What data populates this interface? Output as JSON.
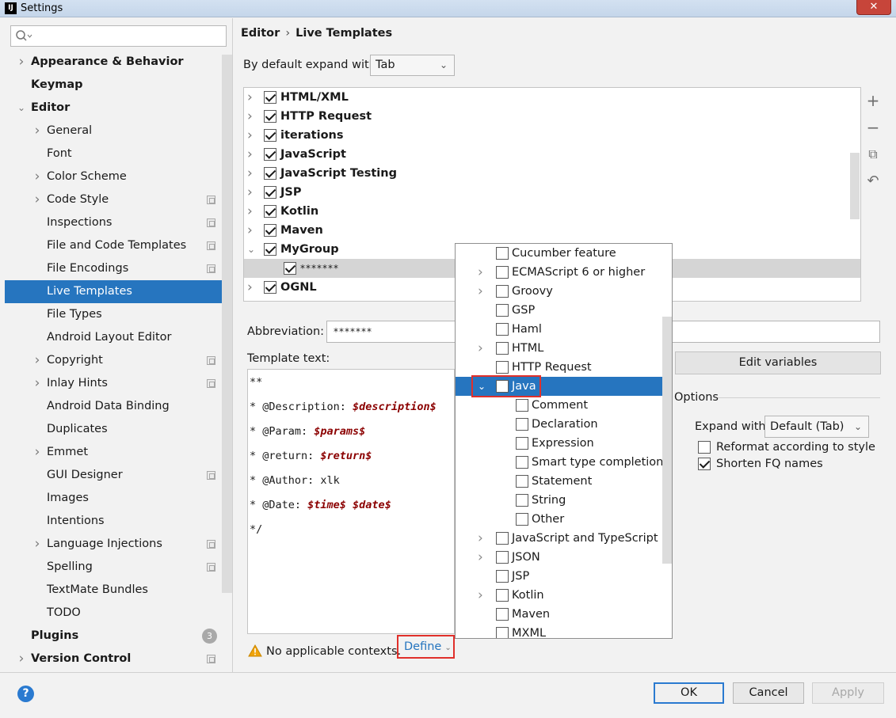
{
  "window": {
    "title": "Settings",
    "app_icon": "IJ",
    "close": "✕"
  },
  "search": {
    "placeholder": ""
  },
  "sidebar": {
    "items": [
      {
        "label": "Appearance & Behavior",
        "bold": true,
        "arrow": "right"
      },
      {
        "label": "Keymap",
        "bold": true
      },
      {
        "label": "Editor",
        "bold": true,
        "arrow": "down"
      },
      {
        "label": "General",
        "arrow": "right",
        "indent": 1
      },
      {
        "label": "Font",
        "indent": 1
      },
      {
        "label": "Color Scheme",
        "arrow": "right",
        "indent": 1
      },
      {
        "label": "Code Style",
        "arrow": "right",
        "indent": 1,
        "project": true
      },
      {
        "label": "Inspections",
        "indent": 1,
        "project": true
      },
      {
        "label": "File and Code Templates",
        "indent": 1,
        "project": true
      },
      {
        "label": "File Encodings",
        "indent": 1,
        "project": true
      },
      {
        "label": "Live Templates",
        "indent": 1,
        "selected": true
      },
      {
        "label": "File Types",
        "indent": 1
      },
      {
        "label": "Android Layout Editor",
        "indent": 1
      },
      {
        "label": "Copyright",
        "arrow": "right",
        "indent": 1,
        "project": true
      },
      {
        "label": "Inlay Hints",
        "arrow": "right",
        "indent": 1,
        "project": true
      },
      {
        "label": "Android Data Binding",
        "indent": 1
      },
      {
        "label": "Duplicates",
        "indent": 1
      },
      {
        "label": "Emmet",
        "arrow": "right",
        "indent": 1
      },
      {
        "label": "GUI Designer",
        "indent": 1,
        "project": true
      },
      {
        "label": "Images",
        "indent": 1
      },
      {
        "label": "Intentions",
        "indent": 1
      },
      {
        "label": "Language Injections",
        "arrow": "right",
        "indent": 1,
        "project": true
      },
      {
        "label": "Spelling",
        "indent": 1,
        "project": true
      },
      {
        "label": "TextMate Bundles",
        "indent": 1
      },
      {
        "label": "TODO",
        "indent": 1
      },
      {
        "label": "Plugins",
        "bold": true,
        "badge": "3"
      },
      {
        "label": "Version Control",
        "bold": true,
        "arrow": "right",
        "project": true
      }
    ]
  },
  "breadcrumb": {
    "parent": "Editor",
    "separator": "›",
    "current": "Live Templates"
  },
  "expand": {
    "label": "By default expand with",
    "value": "Tab"
  },
  "template_groups": [
    {
      "label": "HTML/XML",
      "checked": true,
      "expanded": false
    },
    {
      "label": "HTTP Request",
      "checked": true,
      "expanded": false
    },
    {
      "label": "iterations",
      "checked": true,
      "expanded": false
    },
    {
      "label": "JavaScript",
      "checked": true,
      "expanded": false
    },
    {
      "label": "JavaScript Testing",
      "checked": true,
      "expanded": false
    },
    {
      "label": "JSP",
      "checked": true,
      "expanded": false
    },
    {
      "label": "Kotlin",
      "checked": true,
      "expanded": false
    },
    {
      "label": "Maven",
      "checked": true,
      "expanded": false
    },
    {
      "label": "MyGroup",
      "checked": true,
      "expanded": true
    },
    {
      "label": "*******",
      "checked": true,
      "child": true,
      "selected": true
    },
    {
      "label": "OGNL",
      "checked": true,
      "expanded": false
    }
  ],
  "toolbar": {
    "add": "+",
    "remove": "−",
    "copy": "⧉",
    "undo": "↶"
  },
  "abbreviation": {
    "label": "Abbreviation:",
    "value": "*******"
  },
  "template_text": {
    "label": "Template text:",
    "lines": [
      {
        "text": "**"
      },
      {
        "text": "* @Description: ",
        "var": "$description$"
      },
      {
        "text": "* @Param: ",
        "var": "$params$"
      },
      {
        "text": "* @return: ",
        "var": "$return$"
      },
      {
        "text": "* @Author: xlk"
      },
      {
        "text": "* @Date: ",
        "var": "$time$ $date$"
      },
      {
        "text": "*/"
      }
    ]
  },
  "edit_variables": "Edit variables",
  "options": {
    "label": "Options",
    "expand_with_label": "Expand with",
    "expand_with_value": "Default (Tab)",
    "reformat": {
      "label": "Reformat according to style",
      "checked": false
    },
    "shorten": {
      "label": "Shorten FQ names",
      "checked": true
    }
  },
  "contexts": {
    "warning": "No applicable contexts.",
    "define": "Define"
  },
  "context_popup": [
    {
      "label": "Cucumber feature",
      "checked": false
    },
    {
      "label": "ECMAScript 6 or higher",
      "checked": false,
      "arrow": "right"
    },
    {
      "label": "Groovy",
      "checked": false,
      "arrow": "right"
    },
    {
      "label": "GSP",
      "checked": false
    },
    {
      "label": "Haml",
      "checked": false
    },
    {
      "label": "HTML",
      "checked": false,
      "arrow": "right"
    },
    {
      "label": "HTTP Request",
      "checked": false
    },
    {
      "label": "Java",
      "checked": false,
      "arrow": "down",
      "selected": true
    },
    {
      "label": "Comment",
      "checked": false,
      "child": true
    },
    {
      "label": "Declaration",
      "checked": false,
      "child": true
    },
    {
      "label": "Expression",
      "checked": false,
      "child": true
    },
    {
      "label": "Smart type completion",
      "checked": false,
      "child": true
    },
    {
      "label": "Statement",
      "checked": false,
      "child": true
    },
    {
      "label": "String",
      "checked": false,
      "child": true
    },
    {
      "label": "Other",
      "checked": false,
      "child": true
    },
    {
      "label": "JavaScript and TypeScript",
      "checked": false,
      "arrow": "right"
    },
    {
      "label": "JSON",
      "checked": false,
      "arrow": "right"
    },
    {
      "label": "JSP",
      "checked": false
    },
    {
      "label": "Kotlin",
      "checked": false,
      "arrow": "right"
    },
    {
      "label": "Maven",
      "checked": false
    },
    {
      "label": "MXML",
      "checked": false
    }
  ],
  "buttons": {
    "ok": "OK",
    "cancel": "Cancel",
    "apply": "Apply",
    "help": "?"
  },
  "colors": {
    "selection": "#2675bf",
    "highlight_box": "#e0302b",
    "template_var": "#8b0000"
  }
}
